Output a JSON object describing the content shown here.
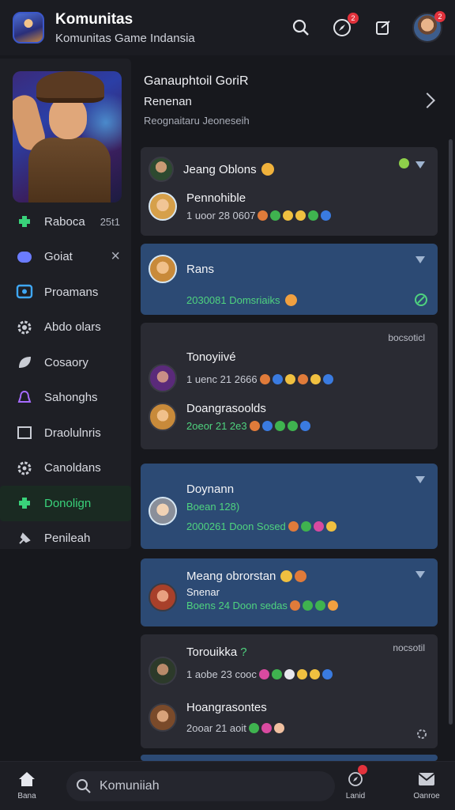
{
  "header": {
    "title": "Komunitas",
    "subtitle": "Komunitas Game Indansia",
    "notif_badge": "2",
    "avatar_badge": "2"
  },
  "sidebar": {
    "items": [
      {
        "label": "Raboca",
        "extra": "25t1",
        "icon": "puzzle-icon",
        "color": "#39d27a"
      },
      {
        "label": "Goiat",
        "extra": "×",
        "icon": "discord-icon",
        "color": "#6b7cff"
      },
      {
        "label": "Proamans",
        "extra": "",
        "icon": "screen-icon",
        "color": "#3fa7f5"
      },
      {
        "label": "Abdo olars",
        "extra": "",
        "icon": "gear-icon",
        "color": "#c9ccd4"
      },
      {
        "label": "Cosaory",
        "extra": "",
        "icon": "leaf-icon",
        "color": "#c9ccd4"
      },
      {
        "label": "Sahonghs",
        "extra": "",
        "icon": "bell-icon",
        "color": "#a66bff"
      },
      {
        "label": "Draolulnris",
        "extra": "",
        "icon": "square-icon",
        "color": "#c9ccd4"
      },
      {
        "label": "Canoldans",
        "extra": "",
        "icon": "cog-icon",
        "color": "#c9ccd4"
      },
      {
        "label": "Donolign",
        "extra": "",
        "icon": "puzzle-icon",
        "color": "#39d27a",
        "active": true
      },
      {
        "label": "Penileah",
        "extra": "",
        "icon": "pin-icon",
        "color": "#c9ccd4"
      }
    ]
  },
  "featured": {
    "title": "Ganauphtoil GoriR",
    "subtitle": "Renenan",
    "meta": "Reognaitaru Jeoneseih"
  },
  "posts": [
    {
      "name1": "Jeang Oblons",
      "name2": "Pennohible",
      "meta": "1 uoor 28 0607",
      "tag": ""
    },
    {
      "name1": "Rans",
      "meta": "2030081 Domsriaiks"
    },
    {
      "name1": "Tonoyiivé",
      "meta1": "1 uenc 21 2666",
      "name2": "Doangrasoolds",
      "meta2": "2oeor 21 2e3",
      "tag": "bocsoticl"
    },
    {
      "name1": "Doynann",
      "sub": "Boean 128)",
      "meta": "2000261 Doon Sosed"
    },
    {
      "name1": "Meang obrorstan",
      "sub": "Snenar",
      "meta": "Boens 24 Doon sedas"
    },
    {
      "name1": "Torouikka",
      "meta1": "1 aobe 23 cooc",
      "name2": "Hoangrasontes",
      "meta2": "2ooar 21 aoit",
      "tag": "nocsotil"
    }
  ],
  "search": {
    "placeholder": "Komuniiah"
  },
  "tabs": {
    "home": "Bana",
    "left": "Lanid",
    "right": "Oanroe"
  },
  "colors": {
    "accent": "#39d27a",
    "blue_card": "#2c4a74",
    "card": "#2a2b33"
  }
}
